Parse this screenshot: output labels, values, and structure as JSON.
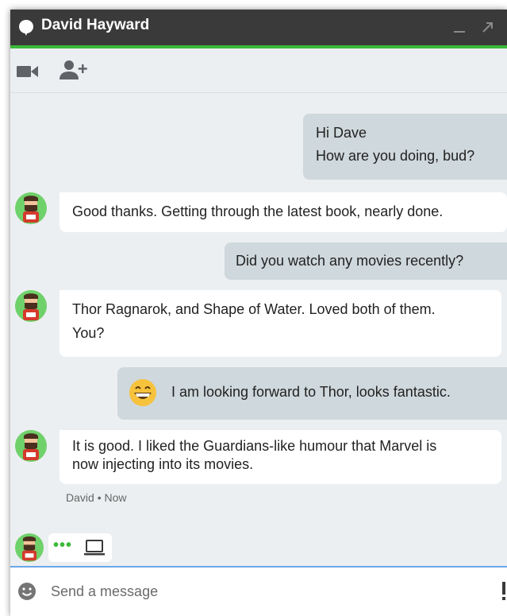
{
  "window": {
    "title": "David Hayward"
  },
  "toolbar": {
    "video_icon": "videocam-icon",
    "add_user_icon": "person-add-icon"
  },
  "messages": [
    {
      "from": "me",
      "lines": [
        "Hi Dave",
        "How are you doing, bud?"
      ]
    },
    {
      "from": "David",
      "lines": [
        "Good thanks. Getting through the latest book, nearly done."
      ]
    },
    {
      "from": "me",
      "lines": [
        "Did you watch any movies recently?"
      ]
    },
    {
      "from": "David",
      "lines": [
        "Thor Ragnarok, and Shape of Water. Loved both of them.",
        "You?"
      ]
    },
    {
      "from": "me",
      "emoji": "grinning-face",
      "lines": [
        "I am looking forward to Thor, looks fantastic."
      ]
    },
    {
      "from": "David",
      "lines": [
        "It is good. I liked the Guardians-like humour that Marvel is",
        "now injecting into its movies."
      ]
    }
  ],
  "meta": {
    "sender": "David",
    "separator": "•",
    "time": "Now"
  },
  "typing": {
    "dots": "•••",
    "device_icon": "laptop-icon"
  },
  "composer": {
    "placeholder": "Send a message"
  },
  "colors": {
    "titlebar": "#3a3a3a",
    "accent_green": "#3cba3c",
    "outgoing_bubble": "#cfd8dc",
    "incoming_bubble": "#ffffff",
    "background": "#eceff1",
    "input_focus": "#6aa6e8"
  }
}
